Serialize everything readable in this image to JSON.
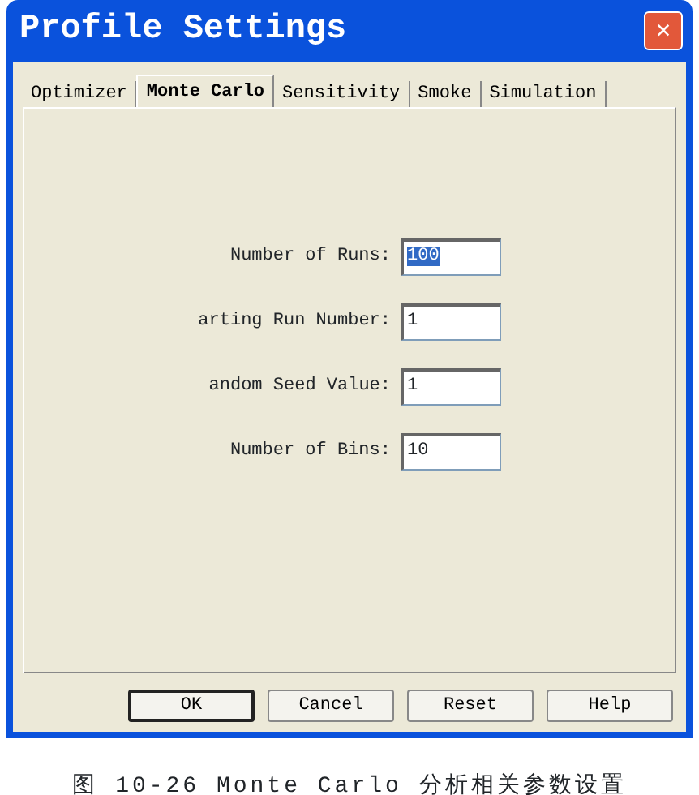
{
  "window": {
    "title": "Profile Settings",
    "close": "✕"
  },
  "tabs": [
    {
      "label": "Optimizer",
      "selected": false
    },
    {
      "label": "Monte Carlo",
      "selected": true
    },
    {
      "label": "Sensitivity",
      "selected": false
    },
    {
      "label": "Smoke",
      "selected": false
    },
    {
      "label": "Simulation",
      "selected": false
    }
  ],
  "fields": [
    {
      "label": "Number of Runs:",
      "value": "100",
      "selected": true
    },
    {
      "label": "arting Run Number:",
      "value": "1",
      "selected": false
    },
    {
      "label": "andom Seed Value:",
      "value": "1",
      "selected": false
    },
    {
      "label": "Number of Bins:",
      "value": "10",
      "selected": false
    }
  ],
  "buttons": [
    {
      "label": "OK",
      "default": true
    },
    {
      "label": "Cancel",
      "default": false
    },
    {
      "label": "Reset",
      "default": false
    },
    {
      "label": "Help",
      "default": false
    }
  ],
  "caption": "图 10-26 Monte Carlo 分析相关参数设置"
}
